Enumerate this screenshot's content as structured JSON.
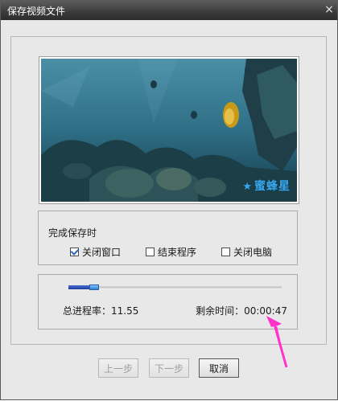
{
  "window": {
    "title": "保存视频文件",
    "close_glyph": "×"
  },
  "preview": {
    "watermark": "蜜蜂星"
  },
  "on_complete": {
    "label": "完成保存时",
    "options": [
      {
        "label": "关闭窗口",
        "checked": true
      },
      {
        "label": "结束程序",
        "checked": false
      },
      {
        "label": "关闭电脑",
        "checked": false
      }
    ]
  },
  "progress": {
    "rate_text": "总进程率：11.55",
    "remaining_text": "剩余时间：00:00:47",
    "value": 0.1155
  },
  "buttons": {
    "prev": "上一步",
    "next": "下一步",
    "cancel": "取消"
  },
  "colors": {
    "title_bar": "#3a3a3a",
    "progress_fill": "#2a4aa8",
    "annotation_arrow": "#ff33cc"
  }
}
